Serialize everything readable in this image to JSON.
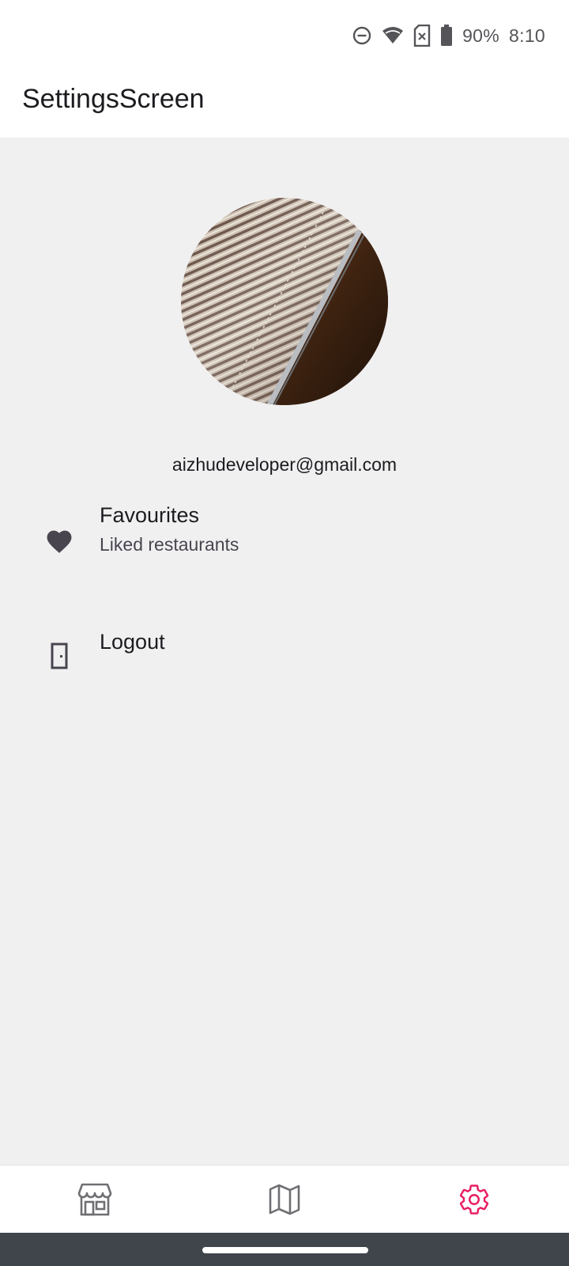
{
  "status_bar": {
    "battery_percent": "90%",
    "time": "8:10",
    "icons": [
      "do-not-disturb-icon",
      "wifi-icon",
      "no-sim-icon",
      "battery-icon"
    ]
  },
  "top_bar": {
    "title": "SettingsScreen"
  },
  "profile": {
    "avatar": "avatar-photo",
    "email": "aizhudeveloper@gmail.com"
  },
  "menu": {
    "favourites": {
      "icon": "heart-icon",
      "title": "Favourites",
      "subtitle": "Liked restaurants"
    },
    "logout": {
      "icon": "door-icon",
      "title": "Logout"
    }
  },
  "bottom_nav": {
    "items": [
      {
        "icon": "store-icon",
        "selected": false
      },
      {
        "icon": "map-icon",
        "selected": false
      },
      {
        "icon": "settings-icon",
        "selected": true
      }
    ],
    "active_color": "#e91e63",
    "inactive_color": "#6f6f73"
  }
}
